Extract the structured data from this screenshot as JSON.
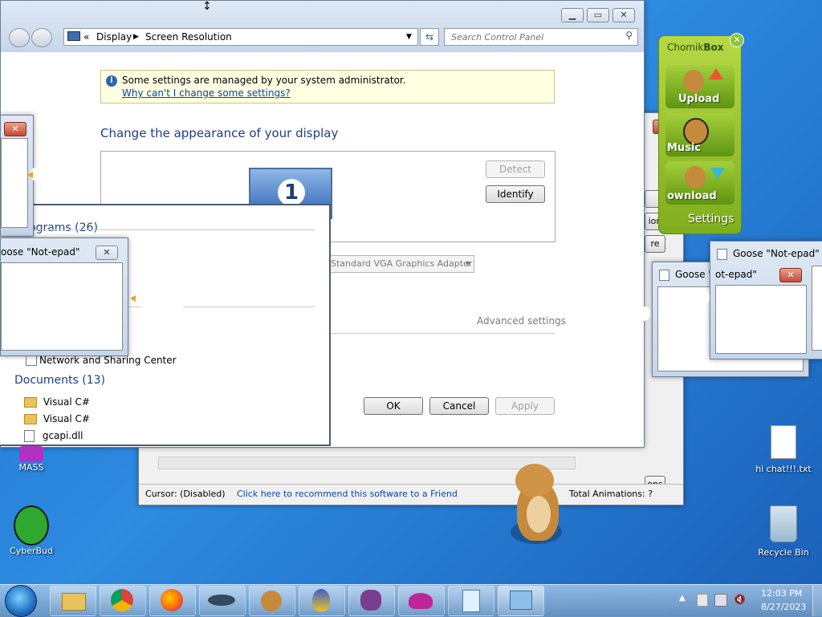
{
  "main": {
    "address": {
      "sep": "«",
      "crumb1": "Display",
      "crumb2": "Screen Resolution"
    },
    "search": {
      "placeholder": "Search Control Panel"
    },
    "info": {
      "text": "Some settings are managed by your system administrator.",
      "link": "Why can't I change some settings?"
    },
    "heading": "Change the appearance of your display",
    "detect": "Detect",
    "identify": "Identify",
    "monitor_number": "1",
    "adapter": "Standard VGA Graphics Adapter",
    "advanced": "Advanced settings",
    "ok": "OK",
    "cancel": "Cancel",
    "apply": "Apply"
  },
  "start_results": {
    "programs": "ograms (26)",
    "network": "Network and Sharing Center",
    "documents_header": "Documents (13)",
    "items": [
      "Visual C#",
      "Visual C#",
      "gcapi.dll"
    ]
  },
  "notepads": {
    "left_title": "oose \"Not-epad\"",
    "mid_title": "Goose \"",
    "right_title": "Goose \"Not-epad\"",
    "inner_title": "ot-epad\""
  },
  "chomik": {
    "title_a": "Chomik",
    "title_b": "Box",
    "upload": "Upload",
    "music": "Music",
    "download": "ownload",
    "settings": "Settings"
  },
  "back_window": {
    "status_cursor": "Cursor: (Disabled)",
    "status_link": "Click here to recommend this software to a Friend",
    "status_anim": "Total Animations: ?",
    "side1": "ion",
    "side2": "re",
    "side3": "ons"
  },
  "desktop": {
    "mass": "MASS",
    "cyberbud": "CyberBud",
    "chat": "hi chat!!!.txt",
    "recycle": "Recycle Bin"
  },
  "tray": {
    "time": "12:03 PM",
    "date": "8/27/2023"
  }
}
